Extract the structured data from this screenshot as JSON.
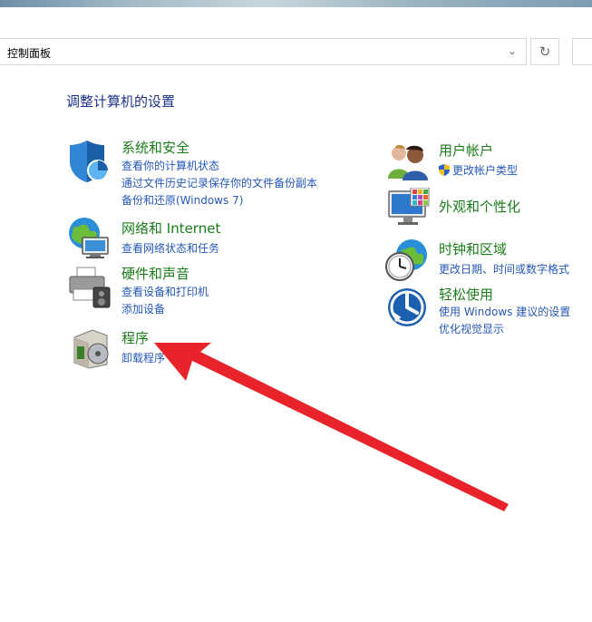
{
  "address_bar": {
    "path": "控制面板"
  },
  "page": {
    "heading": "调整计算机的设置"
  },
  "categories": {
    "security": {
      "title": "系统和安全",
      "links": [
        "查看你的计算机状态",
        "通过文件历史记录保存你的文件备份副本",
        "备份和还原(Windows 7)"
      ]
    },
    "network": {
      "title": "网络和 Internet",
      "links": [
        "查看网络状态和任务"
      ]
    },
    "hardware": {
      "title": "硬件和声音",
      "links": [
        "查看设备和打印机",
        "添加设备"
      ]
    },
    "programs": {
      "title": "程序",
      "links": [
        "卸载程序"
      ]
    },
    "user_accounts": {
      "title": "用户帐户",
      "links": [
        "更改帐户类型"
      ]
    },
    "appearance": {
      "title": "外观和个性化",
      "links": []
    },
    "clock": {
      "title": "时钟和区域",
      "links": [
        "更改日期、时间或数字格式"
      ]
    },
    "ease": {
      "title": "轻松使用",
      "links": [
        "使用 Windows 建议的设置",
        "优化视觉显示"
      ]
    }
  },
  "colors": {
    "category_title": "#1a7d1a",
    "link": "#2558b8",
    "heading": "#1e3287",
    "annotation_arrow": "#e8232a"
  }
}
